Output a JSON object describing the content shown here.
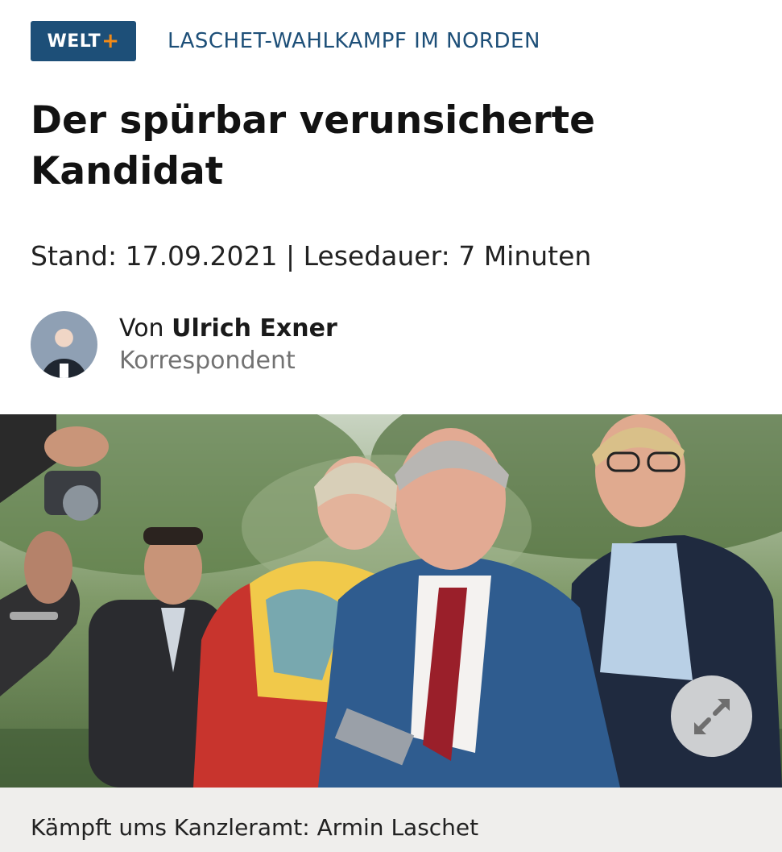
{
  "brand": {
    "logo_text": "WELT",
    "logo_plus": "+",
    "logo_color": "#1d4f78",
    "plus_color": "#f28a16"
  },
  "article": {
    "kicker": "LASCHET-WAHLKAMPF IM NORDEN",
    "headline_line1": "Der spürbar verunsicherte",
    "headline_line2": "Kandidat",
    "meta": "Stand: 17.09.2021 | Lesedauer: 7 Minuten"
  },
  "author": {
    "prefix": "Von ",
    "name": "Ulrich Exner",
    "role": "Korrespondent"
  },
  "media": {
    "expand_icon": "expand-arrows-icon",
    "caption": "Kämpft ums Kanzleramt: Armin Laschet"
  }
}
